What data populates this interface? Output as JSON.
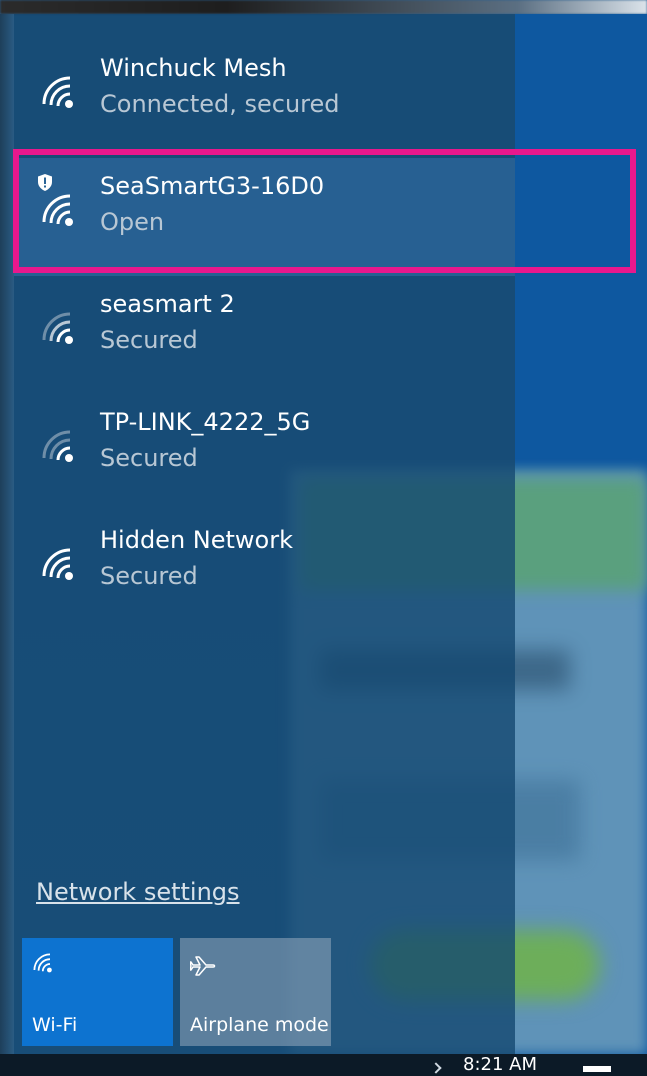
{
  "networks": [
    {
      "name": "Winchuck Mesh",
      "status": "Connected, secured",
      "icon": "wifi-signal-icon",
      "selected": false,
      "shield": false,
      "dim": false
    },
    {
      "name": "SeaSmartG3-16D0",
      "status": "Open",
      "icon": "wifi-signal-icon",
      "selected": true,
      "shield": true,
      "dim": false
    },
    {
      "name": "seasmart 2",
      "status": "Secured",
      "icon": "wifi-signal-icon",
      "selected": false,
      "shield": false,
      "dim": true
    },
    {
      "name": "TP-LINK_4222_5G",
      "status": "Secured",
      "icon": "wifi-signal-icon",
      "selected": false,
      "shield": false,
      "dim": true
    },
    {
      "name": "Hidden Network",
      "status": "Secured",
      "icon": "wifi-signal-icon",
      "selected": false,
      "shield": false,
      "dim": false
    }
  ],
  "settings_link": "Network settings",
  "tiles": {
    "wifi": {
      "label": "Wi-Fi",
      "icon": "wifi-icon",
      "active": true
    },
    "airplane": {
      "label": "Airplane mode",
      "icon": "airplane-icon",
      "active": false
    }
  },
  "taskbar": {
    "time": "8:21 AM"
  },
  "colors": {
    "highlight": "#e8188d",
    "accent": "#0d73d0",
    "flyout": "#124670"
  }
}
